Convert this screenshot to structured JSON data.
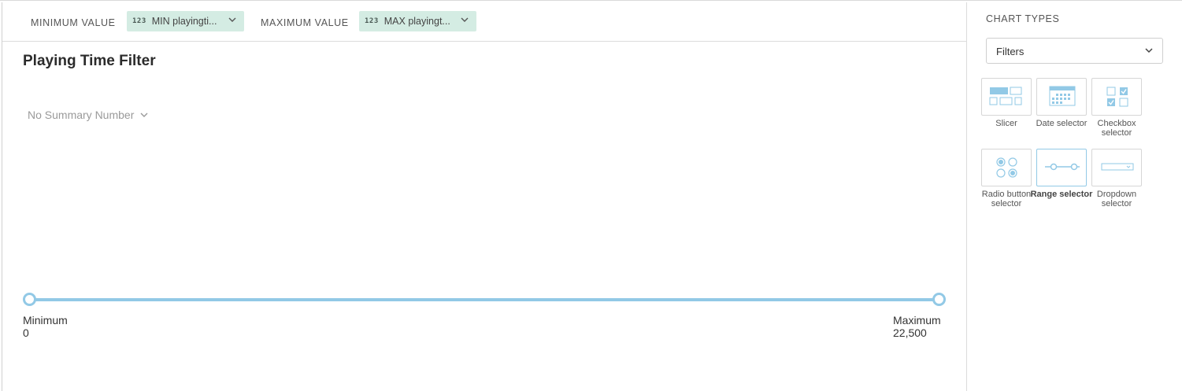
{
  "fieldbar": {
    "min_label": "MINIMUM VALUE",
    "min_pill": {
      "type_icon": "123",
      "text": "MIN playingti..."
    },
    "max_label": "MAXIMUM VALUE",
    "max_pill": {
      "type_icon": "123",
      "text": "MAX playingt..."
    }
  },
  "chart": {
    "title": "Playing Time Filter",
    "summary_dropdown": "No Summary Number",
    "range": {
      "min_label": "Minimum",
      "min_value": "0",
      "max_label": "Maximum",
      "max_value": "22,500"
    }
  },
  "panel": {
    "title": "CHART TYPES",
    "select_value": "Filters",
    "chart_types": [
      {
        "label": "Slicer",
        "icon": "slicer-icon"
      },
      {
        "label": "Date selector",
        "icon": "date-selector-icon"
      },
      {
        "label": "Checkbox selector",
        "icon": "checkbox-selector-icon"
      },
      {
        "label": "Radio button selector",
        "icon": "radio-button-selector-icon"
      },
      {
        "label": "Range selector",
        "icon": "range-selector-icon",
        "selected": true
      },
      {
        "label": "Dropdown selector",
        "icon": "dropdown-selector-icon"
      }
    ]
  },
  "colors": {
    "accent": "#92c9e6",
    "pill_bg": "#d4ece3"
  }
}
